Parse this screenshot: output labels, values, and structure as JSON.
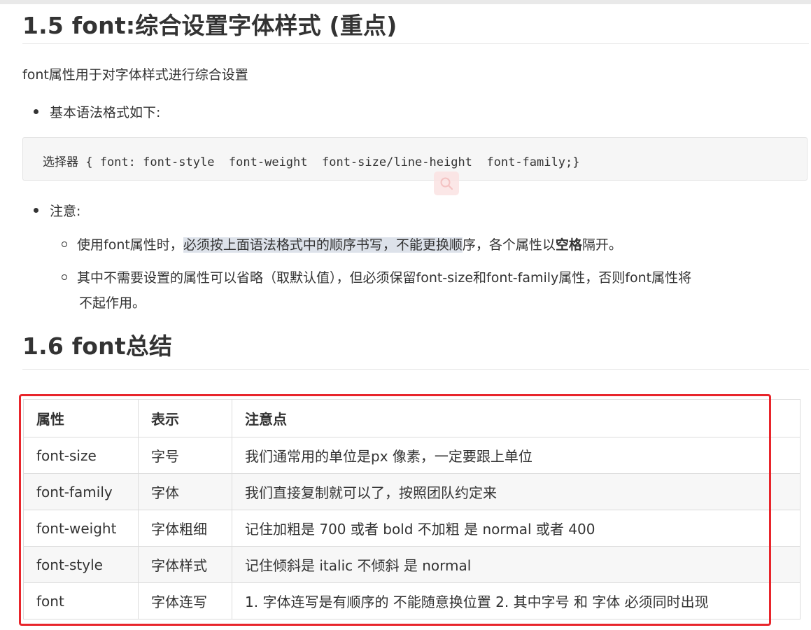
{
  "section_15": {
    "title": "1.5 font:综合设置字体样式 (重点)",
    "intro": "font属性用于对字体样式进行综合设置",
    "bullet_syntax": "基本语法格式如下:",
    "code": "选择器 { font: font-style  font-weight  font-size/line-height  font-family;}",
    "bullet_note": "注意:",
    "note1_pre": "使用font属性时，",
    "note1_highlight": "必须按上面语法格式中的顺序书写，不能更换顺",
    "note1_post_a": "序，各个属性以",
    "note1_bold": "空格",
    "note1_post_b": "隔开。",
    "note2_line1": "其中不需要设置的属性可以省略（取默认值），但必须保留font-size和font-family属性，否则font属性将",
    "note2_line2": "不起作用。"
  },
  "section_16": {
    "title": "1.6 font总结",
    "headers": [
      "属性",
      "表示",
      "注意点"
    ],
    "rows": [
      [
        "font-size",
        "字号",
        "我们通常用的单位是px 像素，一定要跟上单位"
      ],
      [
        "font-family",
        "字体",
        "我们直接复制就可以了，按照团队约定来"
      ],
      [
        "font-weight",
        "字体粗细",
        "记住加粗是 700 或者 bold  不加粗 是 normal 或者  400"
      ],
      [
        "font-style",
        "字体样式",
        "记住倾斜是 italic    不倾斜 是 normal"
      ],
      [
        "font",
        "字体连写",
        "1. 字体连写是有顺序的  不能随意换位置 2. 其中字号 和 字体 必须同时出现"
      ]
    ]
  },
  "colors": {
    "highlight_box": "#e8252b",
    "text": "#333333",
    "selection": "#dde2ea"
  },
  "icons": {
    "floating_badge": "search-icon"
  }
}
